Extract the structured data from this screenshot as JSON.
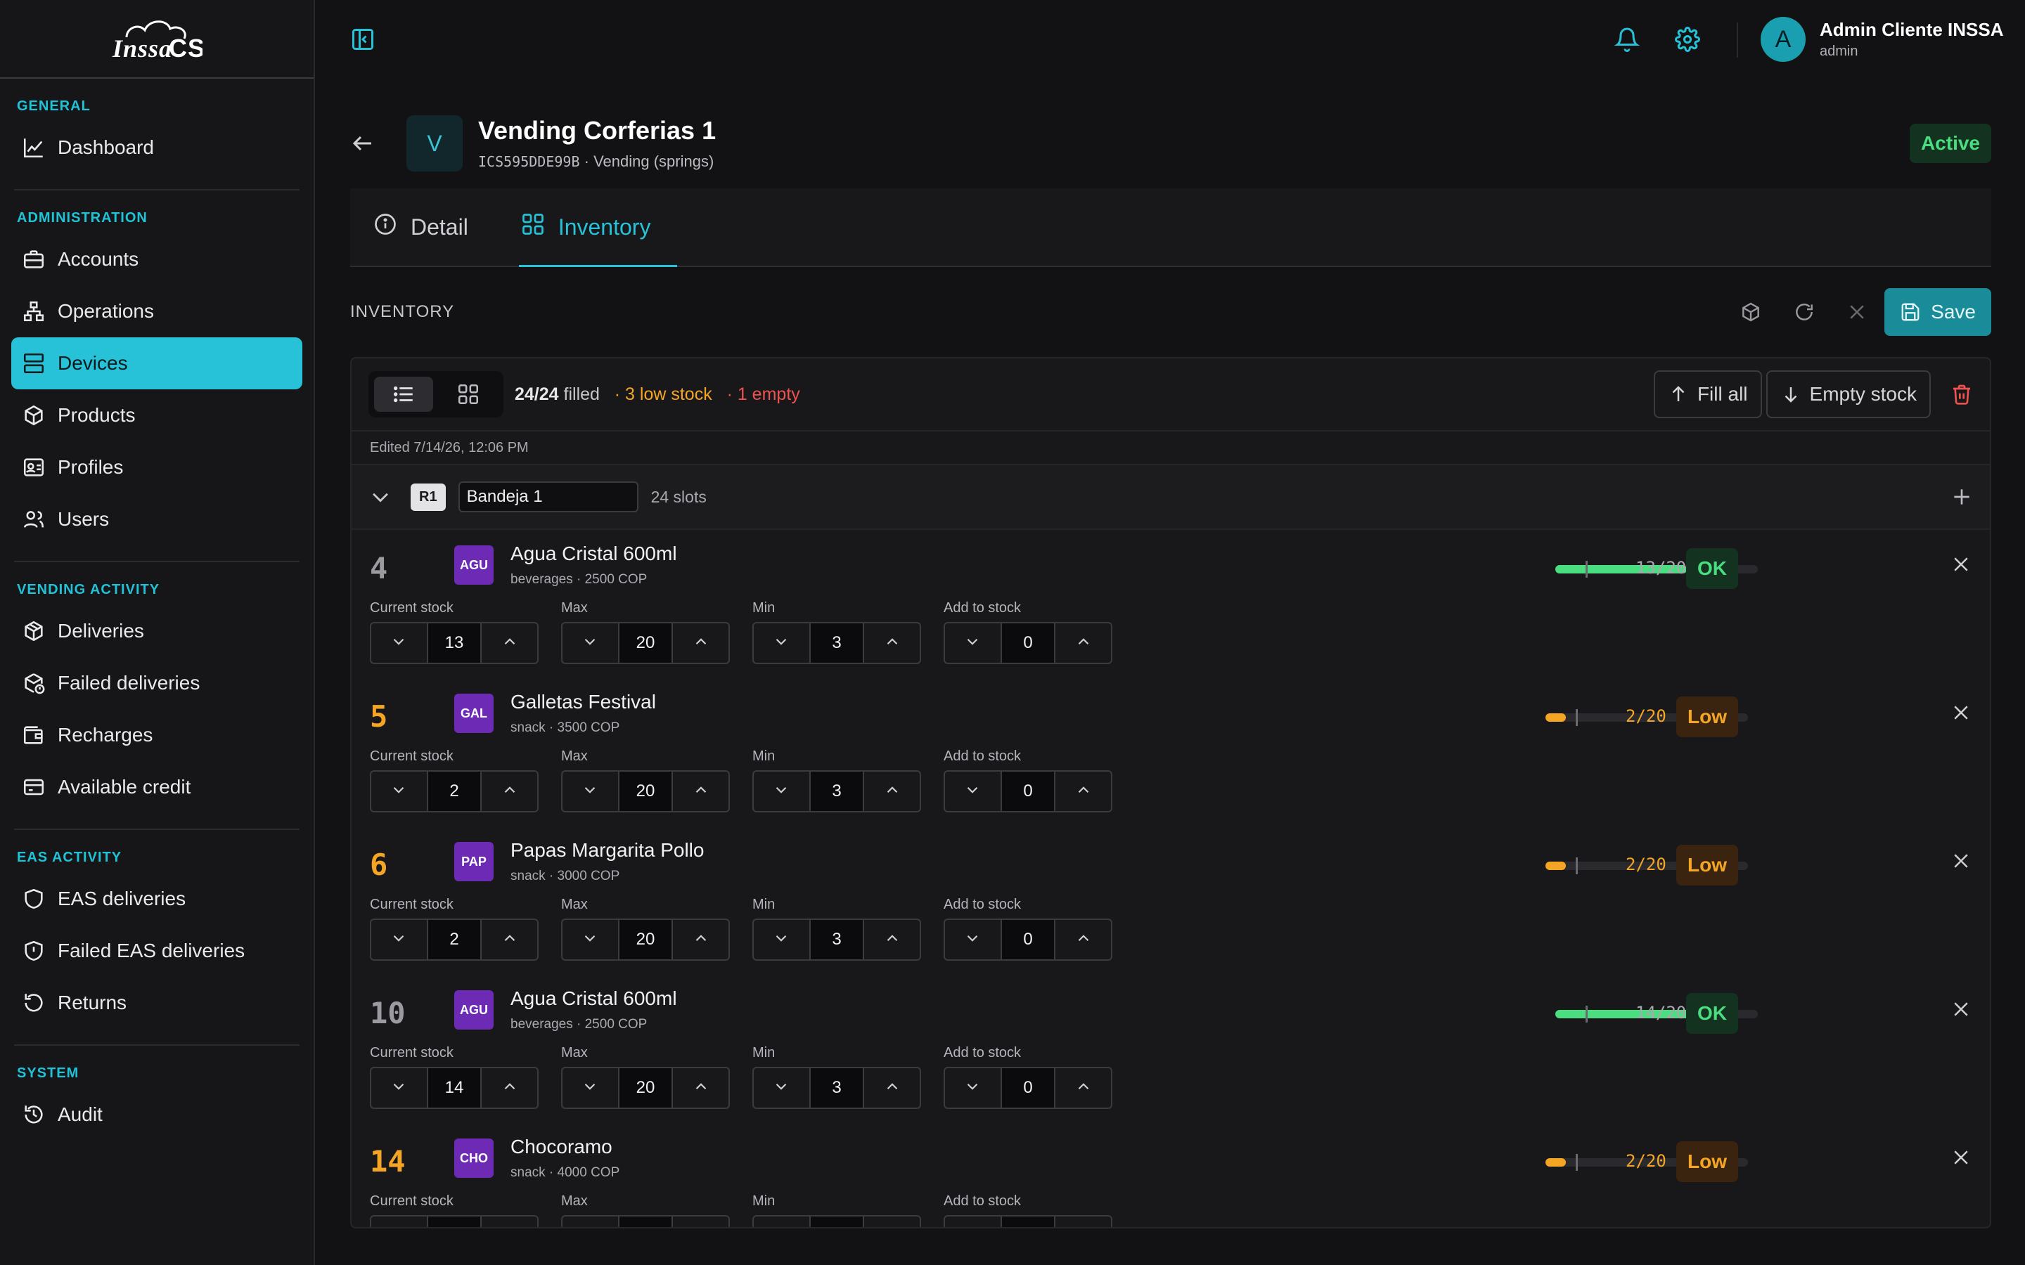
{
  "brand": {
    "logo_text": "Inssa CS"
  },
  "user": {
    "name": "Admin Cliente INSSA",
    "role": "admin",
    "initial": "A"
  },
  "colors": {
    "accent": "#27c2d8",
    "ok": "#4ade80",
    "low": "#f5a524",
    "danger": "#ef5350",
    "chip": "#6d2bb5"
  },
  "sidebar": {
    "sections": [
      {
        "title": "GENERAL",
        "items": [
          {
            "label": "Dashboard",
            "icon": "chart-line-icon"
          }
        ]
      },
      {
        "title": "ADMINISTRATION",
        "items": [
          {
            "label": "Accounts",
            "icon": "briefcase-icon"
          },
          {
            "label": "Operations",
            "icon": "network-icon"
          },
          {
            "label": "Devices",
            "icon": "server-icon",
            "active": true
          },
          {
            "label": "Products",
            "icon": "box-icon"
          },
          {
            "label": "Profiles",
            "icon": "id-card-icon"
          },
          {
            "label": "Users",
            "icon": "users-icon"
          }
        ]
      },
      {
        "title": "VENDING ACTIVITY",
        "items": [
          {
            "label": "Deliveries",
            "icon": "package-icon"
          },
          {
            "label": "Failed deliveries",
            "icon": "package-alert-icon"
          },
          {
            "label": "Recharges",
            "icon": "wallet-icon"
          },
          {
            "label": "Available credit",
            "icon": "credit-card-icon"
          }
        ]
      },
      {
        "title": "EAS ACTIVITY",
        "items": [
          {
            "label": "EAS deliveries",
            "icon": "shield-icon"
          },
          {
            "label": "Failed EAS deliveries",
            "icon": "shield-alert-icon"
          },
          {
            "label": "Returns",
            "icon": "undo-icon"
          }
        ]
      },
      {
        "title": "SYSTEM",
        "items": [
          {
            "label": "Audit",
            "icon": "history-icon"
          }
        ]
      }
    ]
  },
  "device": {
    "initial": "V",
    "title": "Vending Corferias 1",
    "code": "ICS595DDE99B",
    "type": "Vending (springs)",
    "status": "Active"
  },
  "tabs": [
    {
      "label": "Detail",
      "icon": "info-icon"
    },
    {
      "label": "Inventory",
      "icon": "grid-icon",
      "active": true
    }
  ],
  "inventory": {
    "title": "INVENTORY",
    "save_label": "Save",
    "filled": "24/24",
    "filled_word": "filled",
    "low_stock": "· 3 low stock",
    "empty": "· 1 empty",
    "fill_all": "Fill all",
    "empty_stock": "Empty stock",
    "edited": "Edited 7/14/26, 12:06 PM",
    "tray": {
      "code": "R1",
      "name": "Bandeja 1",
      "slots": "24 slots"
    },
    "field_labels": {
      "current": "Current stock",
      "max": "Max",
      "min": "Min",
      "add": "Add to stock"
    },
    "items": [
      {
        "slot": "4",
        "chip": "AGU",
        "name": "Agua Cristal 600ml",
        "meta": "beverages  · 2500 COP",
        "ratio": "13/20",
        "status": "OK",
        "level": 0.65,
        "current": "13",
        "max": "20",
        "min": "3",
        "add": "0"
      },
      {
        "slot": "5",
        "chip": "GAL",
        "name": "Galletas Festival",
        "meta": "snack  · 3500 COP",
        "ratio": "2/20",
        "status": "Low",
        "level": 0.1,
        "current": "2",
        "max": "20",
        "min": "3",
        "add": "0"
      },
      {
        "slot": "6",
        "chip": "PAP",
        "name": "Papas Margarita Pollo",
        "meta": "snack  · 3000 COP",
        "ratio": "2/20",
        "status": "Low",
        "level": 0.1,
        "current": "2",
        "max": "20",
        "min": "3",
        "add": "0"
      },
      {
        "slot": "10",
        "chip": "AGU",
        "name": "Agua Cristal 600ml",
        "meta": "beverages  · 2500 COP",
        "ratio": "14/20",
        "status": "OK",
        "level": 0.7,
        "current": "14",
        "max": "20",
        "min": "3",
        "add": "0"
      },
      {
        "slot": "14",
        "chip": "CHO",
        "name": "Chocoramo",
        "meta": "snack  · 4000 COP",
        "ratio": "2/20",
        "status": "Low",
        "level": 0.1,
        "current": "",
        "max": "",
        "min": "",
        "add": ""
      }
    ]
  }
}
